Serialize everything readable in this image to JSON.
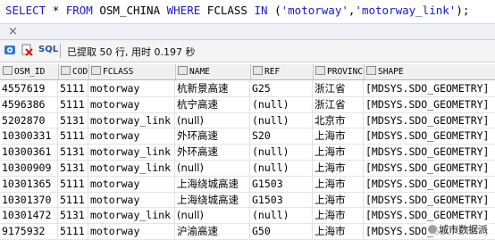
{
  "editor": {
    "kw_select": "SELECT",
    "star": " * ",
    "kw_from": "FROM",
    "table": " OSM_CHINA ",
    "kw_where": "WHERE",
    "field": " FCLASS ",
    "kw_in": "IN",
    "args_open": " (",
    "val1": "'motorway'",
    "comma": ",",
    "val2": "'motorway_link'",
    "args_close": ");"
  },
  "tab": {
    "close": "×"
  },
  "toolbar": {
    "sql_label": "SQL",
    "status": "已提取 50 行, 用时 0.197 秒"
  },
  "columns": [
    "OSM_ID",
    "CODE",
    "FCLASS",
    "NAME",
    "REF",
    "PROVINCE",
    "SHAPE"
  ],
  "rows": [
    [
      "4557619",
      "5111",
      "motorway",
      "杭新景高速",
      "G25",
      "浙江省",
      "[MDSYS.SDO_GEOMETRY]"
    ],
    [
      "4596386",
      "5111",
      "motorway",
      "杭宁高速",
      "(null)",
      "浙江省",
      "[MDSYS.SDO_GEOMETRY]"
    ],
    [
      "5202870",
      "5131",
      "motorway_link",
      "(null)",
      "(null)",
      "北京市",
      "[MDSYS.SDO_GEOMETRY]"
    ],
    [
      "10300331",
      "5111",
      "motorway",
      "外环高速",
      "S20",
      "上海市",
      "[MDSYS.SDO_GEOMETRY]"
    ],
    [
      "10300361",
      "5131",
      "motorway_link",
      "外环高速",
      "(null)",
      "上海市",
      "[MDSYS.SDO_GEOMETRY]"
    ],
    [
      "10300909",
      "5131",
      "motorway_link",
      "(null)",
      "(null)",
      "上海市",
      "[MDSYS.SDO_GEOMETRY]"
    ],
    [
      "10301365",
      "5111",
      "motorway",
      "上海绕城高速",
      "G1503",
      "上海市",
      "[MDSYS.SDO_GEOMETRY]"
    ],
    [
      "10301370",
      "5111",
      "motorway",
      "上海绕城高速",
      "G1503",
      "上海市",
      "[MDSYS.SDO_GEOMETRY]"
    ],
    [
      "10301472",
      "5131",
      "motorway_link",
      "(null)",
      "(null)",
      "上海市",
      "[MDSYS.SDO_GEOMETRY]"
    ],
    [
      "9175932",
      "5111",
      "motorway",
      "沪渝高速",
      "G50",
      "上海市",
      "[MDSYS.SDO_GEOMETRY]"
    ]
  ],
  "watermark": "城市数据派",
  "colors": {
    "keyword": "#1a1ac8",
    "header_bg": "#f0f0f0"
  }
}
